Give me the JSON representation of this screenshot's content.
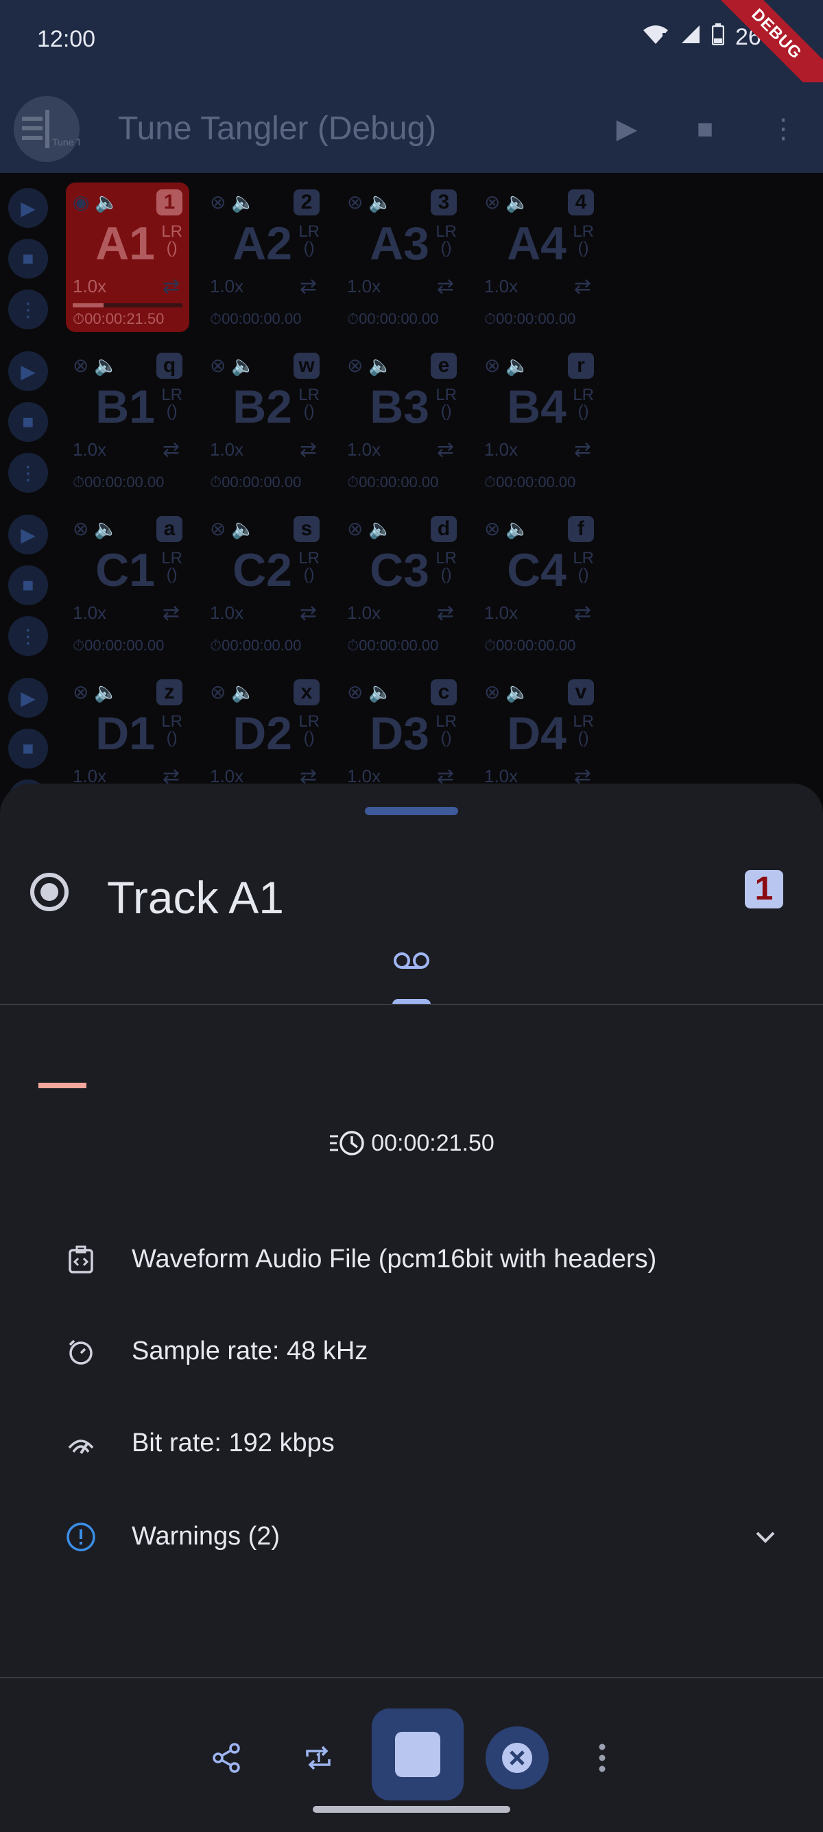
{
  "status_bar": {
    "time": "12:00",
    "battery": "26%",
    "ribbon": "DEBUG"
  },
  "app_bar": {
    "title": "Tune Tangler (Debug)",
    "logo_text": "Tune Tangler"
  },
  "grid": {
    "rows": [
      {
        "pads": [
          {
            "label": "A1",
            "key": "1",
            "speed": "1.0x",
            "duration": "00:00:21.50",
            "active": true,
            "progress": 0.28
          },
          {
            "label": "A2",
            "key": "2",
            "speed": "1.0x",
            "duration": "00:00:00.00"
          },
          {
            "label": "A3",
            "key": "3",
            "speed": "1.0x",
            "duration": "00:00:00.00"
          },
          {
            "label": "A4",
            "key": "4",
            "speed": "1.0x",
            "duration": "00:00:00.00"
          }
        ]
      },
      {
        "pads": [
          {
            "label": "B1",
            "key": "q",
            "speed": "1.0x",
            "duration": "00:00:00.00"
          },
          {
            "label": "B2",
            "key": "w",
            "speed": "1.0x",
            "duration": "00:00:00.00"
          },
          {
            "label": "B3",
            "key": "e",
            "speed": "1.0x",
            "duration": "00:00:00.00"
          },
          {
            "label": "B4",
            "key": "r",
            "speed": "1.0x",
            "duration": "00:00:00.00"
          }
        ]
      },
      {
        "pads": [
          {
            "label": "C1",
            "key": "a",
            "speed": "1.0x",
            "duration": "00:00:00.00"
          },
          {
            "label": "C2",
            "key": "s",
            "speed": "1.0x",
            "duration": "00:00:00.00"
          },
          {
            "label": "C3",
            "key": "d",
            "speed": "1.0x",
            "duration": "00:00:00.00"
          },
          {
            "label": "C4",
            "key": "f",
            "speed": "1.0x",
            "duration": "00:00:00.00"
          }
        ]
      },
      {
        "pads": [
          {
            "label": "D1",
            "key": "z",
            "speed": "1.0x",
            "duration": ""
          },
          {
            "label": "D2",
            "key": "x",
            "speed": "1.0x",
            "duration": ""
          },
          {
            "label": "D3",
            "key": "c",
            "speed": "1.0x",
            "duration": ""
          },
          {
            "label": "D4",
            "key": "v",
            "speed": "1.0x",
            "duration": ""
          }
        ]
      }
    ],
    "lr_label": "LR"
  },
  "sheet": {
    "title": "Track A1",
    "key_badge": "1",
    "duration": "00:00:21.50",
    "format": "Waveform Audio File (pcm16bit with headers)",
    "sample_rate": "Sample rate: 48 kHz",
    "bit_rate": "Bit rate: 192 kbps",
    "warnings": "Warnings (2)"
  },
  "colors": {
    "accent": "#9fb6f2",
    "active_pad": "#7a0f12",
    "warning": "#3b8ee8"
  }
}
